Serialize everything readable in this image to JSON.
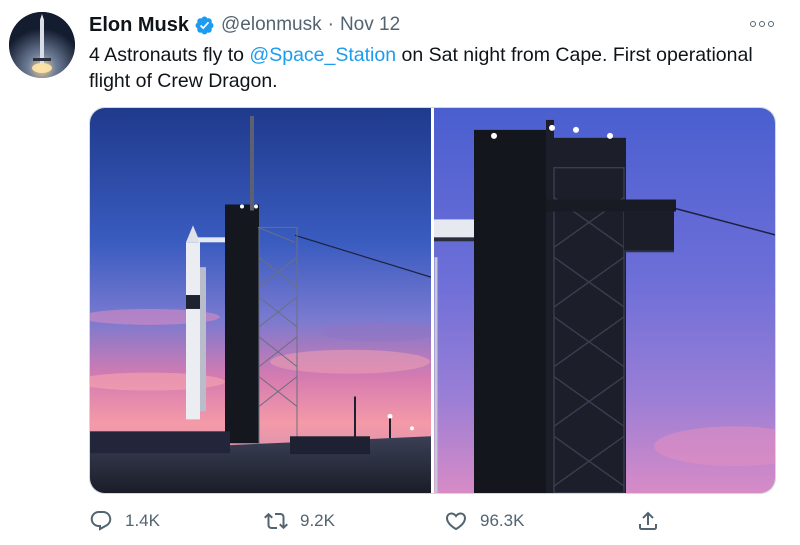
{
  "author": {
    "name": "Elon Musk",
    "handle": "@elonmusk",
    "separator": "·",
    "date": "Nov 12",
    "verified": true
  },
  "tweet": {
    "text_before": "4 Astronauts fly to ",
    "mention": "@Space_Station",
    "text_after": " on Sat night from Cape. First operational flight of Crew Dragon."
  },
  "media": [
    {
      "icon": "rocket-launchpad-photo"
    },
    {
      "icon": "launch-tower-closeup-photo"
    }
  ],
  "actions": {
    "reply": {
      "icon": "reply-icon",
      "count": "1.4K"
    },
    "retweet": {
      "icon": "retweet-icon",
      "count": "9.2K"
    },
    "like": {
      "icon": "heart-icon",
      "count": "96.3K"
    },
    "share": {
      "icon": "share-icon"
    }
  },
  "colors": {
    "link": "#1d9bf0",
    "secondary_text": "#536471",
    "verified_badge": "#1d9bf0"
  }
}
